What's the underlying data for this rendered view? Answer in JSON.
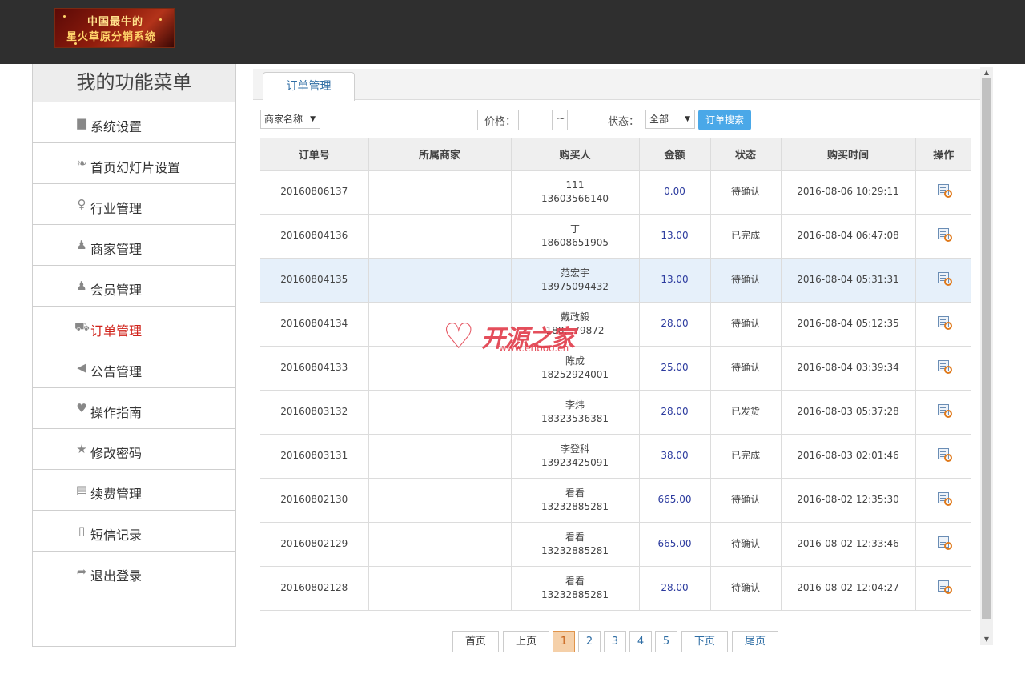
{
  "logo": {
    "line1": "中国最牛的",
    "line2": "星火草原分销系统"
  },
  "sidebar": {
    "title": "我的功能菜单",
    "items": [
      {
        "label": "系统设置",
        "icon": "store-icon",
        "glyph": "▆"
      },
      {
        "label": "首页幻灯片设置",
        "icon": "slides-icon",
        "glyph": "❧"
      },
      {
        "label": "行业管理",
        "icon": "pin-icon",
        "glyph": "♀"
      },
      {
        "label": "商家管理",
        "icon": "user-star-icon",
        "glyph": "♟"
      },
      {
        "label": "会员管理",
        "icon": "users-icon",
        "glyph": "♟"
      },
      {
        "label": "订单管理",
        "icon": "cart-icon",
        "glyph": "⛟",
        "active": true
      },
      {
        "label": "公告管理",
        "icon": "speaker-icon",
        "glyph": "◀"
      },
      {
        "label": "操作指南",
        "icon": "heart-icon",
        "glyph": "♥"
      },
      {
        "label": "修改密码",
        "icon": "star-icon",
        "glyph": "★"
      },
      {
        "label": "续费管理",
        "icon": "book-icon",
        "glyph": "▤"
      },
      {
        "label": "短信记录",
        "icon": "phone-icon",
        "glyph": "▯"
      },
      {
        "label": "退出登录",
        "icon": "share-arrow-icon",
        "glyph": "➦"
      }
    ]
  },
  "tabs": [
    {
      "label": "订单管理",
      "active": true
    }
  ],
  "filter": {
    "merchant_select": "商家名称",
    "merchant_input": "",
    "price_label": "价格：",
    "price_min": "",
    "tilde": "~",
    "price_max": "",
    "status_label": "状态：",
    "status_select": "全部",
    "search_button": "订单搜索"
  },
  "table": {
    "headers": [
      "订单号",
      "所属商家",
      "购买人",
      "金额",
      "状态",
      "购买时间",
      "操作"
    ],
    "rows": [
      {
        "order_no": "20160806137",
        "merchant": "",
        "buyer_name": "111",
        "buyer_phone": "13603566140",
        "amount": "0.00",
        "status": "待确认",
        "time": "2016-08-06 10:29:11"
      },
      {
        "order_no": "20160804136",
        "merchant": "",
        "buyer_name": "丁",
        "buyer_phone": "18608651905",
        "amount": "13.00",
        "status": "已完成",
        "time": "2016-08-04 06:47:08"
      },
      {
        "order_no": "20160804135",
        "merchant": "",
        "buyer_name": "范宏宇",
        "buyer_phone": "13975094432",
        "amount": "13.00",
        "status": "待确认",
        "time": "2016-08-04 05:31:31",
        "highlight": true
      },
      {
        "order_no": "20160804134",
        "merchant": "",
        "buyer_name": "戴政毅",
        "buyer_phone": "188…79872",
        "amount": "28.00",
        "status": "待确认",
        "time": "2016-08-04 05:12:35"
      },
      {
        "order_no": "20160804133",
        "merchant": "",
        "buyer_name": "陈成",
        "buyer_phone": "18252924001",
        "amount": "25.00",
        "status": "待确认",
        "time": "2016-08-04 03:39:34"
      },
      {
        "order_no": "20160803132",
        "merchant": "",
        "buyer_name": "李炜",
        "buyer_phone": "18323536381",
        "amount": "28.00",
        "status": "已发货",
        "time": "2016-08-03 05:37:28"
      },
      {
        "order_no": "20160803131",
        "merchant": "",
        "buyer_name": "李登科",
        "buyer_phone": "13923425091",
        "amount": "38.00",
        "status": "已完成",
        "time": "2016-08-03 02:01:46"
      },
      {
        "order_no": "20160802130",
        "merchant": "",
        "buyer_name": "看看",
        "buyer_phone": "13232885281",
        "amount": "665.00",
        "status": "待确认",
        "time": "2016-08-02 12:35:30"
      },
      {
        "order_no": "20160802129",
        "merchant": "",
        "buyer_name": "看看",
        "buyer_phone": "13232885281",
        "amount": "665.00",
        "status": "待确认",
        "time": "2016-08-02 12:33:46"
      },
      {
        "order_no": "20160802128",
        "merchant": "",
        "buyer_name": "看看",
        "buyer_phone": "13232885281",
        "amount": "28.00",
        "status": "待确认",
        "time": "2016-08-02 12:04:27"
      }
    ]
  },
  "pager": {
    "first": "首页",
    "prev": "上页",
    "pages": [
      "1",
      "2",
      "3",
      "4",
      "5"
    ],
    "current": "1",
    "next": "下页",
    "last": "尾页"
  },
  "watermark": {
    "text": "开源之家",
    "url": "www.enboo.cn"
  },
  "colors": {
    "accent_blue": "#4aa8e8",
    "active_menu_red": "#d0231b",
    "amount_blue": "#2b3a9e",
    "row_highlight": "#e6f0fa"
  }
}
